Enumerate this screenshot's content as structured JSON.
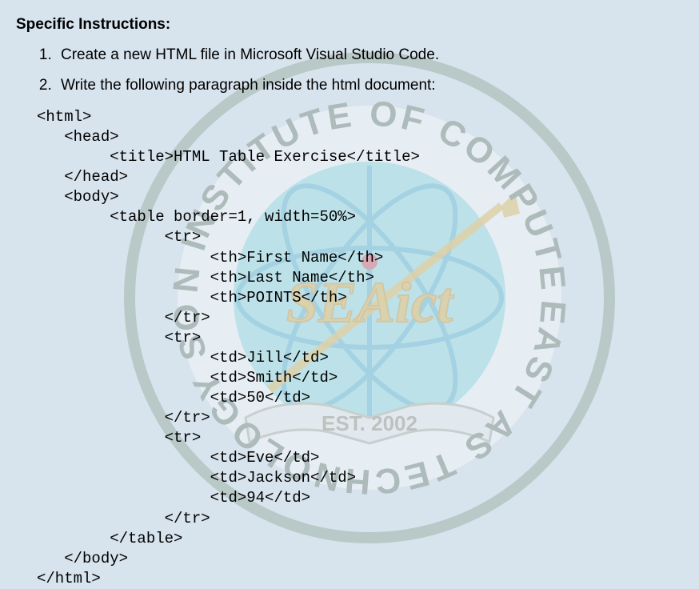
{
  "heading": "Specific Instructions:",
  "instructions": [
    "Create a new HTML file in Microsoft Visual Studio Code.",
    "Write the following paragraph inside the html document:"
  ],
  "code": {
    "l1": "<html>",
    "l2": "   <head>",
    "l3": "        <title>HTML Table Exercise</title>",
    "l4": "   </head>",
    "l5": "   <body>",
    "l6": "        <table border=1, width=50%>",
    "l7": "              <tr>",
    "l8": "                   <th>First Name</th>",
    "l9": "                   <th>Last Name</th>",
    "l10": "                   <th>POINTS</th>",
    "l11": "              </tr>",
    "l12": "              <tr>",
    "l13": "                   <td>Jill</td>",
    "l14": "                   <td>Smith</td>",
    "l15": "                   <td>50</td>",
    "l16": "              </tr>",
    "l17": "              <tr>",
    "l18": "                   <td>Eve</td>",
    "l19": "                   <td>Jackson</td>",
    "l20": "                   <td>94</td>",
    "l21": "              </tr>",
    "l22": "        </table>",
    "l23": "   </body>",
    "l24": "</html>"
  },
  "watermark": {
    "outer_text": "ASIAN INSTITUTE OF COMPUTER TECHNOLOGY SOUTHEAST",
    "center_abbrev": "SEAict",
    "established": "EST. 2002"
  }
}
